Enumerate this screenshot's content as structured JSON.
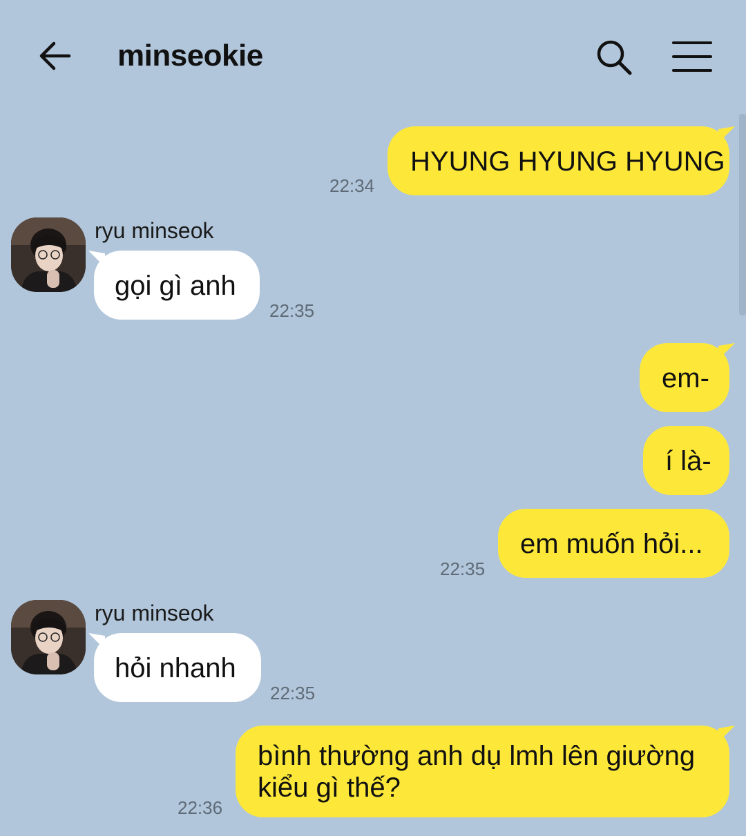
{
  "header": {
    "title": "minseokie",
    "back_icon": "arrow-left-icon",
    "search_icon": "search-icon",
    "menu_icon": "hamburger-menu-icon"
  },
  "colors": {
    "background": "#b1c6db",
    "my_bubble": "#fde83a",
    "their_bubble": "#ffffff"
  },
  "messages": [
    {
      "from": "me",
      "text": "HYUNG HYUNG HYUNG",
      "time": "22:34"
    },
    {
      "from": "them",
      "sender": "ryu minseok",
      "text": "gọi gì anh",
      "time": "22:35"
    },
    {
      "from": "me",
      "text": "em-"
    },
    {
      "from": "me",
      "text": "í là-"
    },
    {
      "from": "me",
      "text": "em muốn hỏi...",
      "time": "22:35"
    },
    {
      "from": "them",
      "sender": "ryu minseok",
      "text": "hỏi nhanh",
      "time": "22:35"
    },
    {
      "from": "me",
      "text_lines": [
        "bình thường anh dụ lmh lên giường",
        "kiểu gì thế?"
      ],
      "time": "22:36"
    }
  ]
}
